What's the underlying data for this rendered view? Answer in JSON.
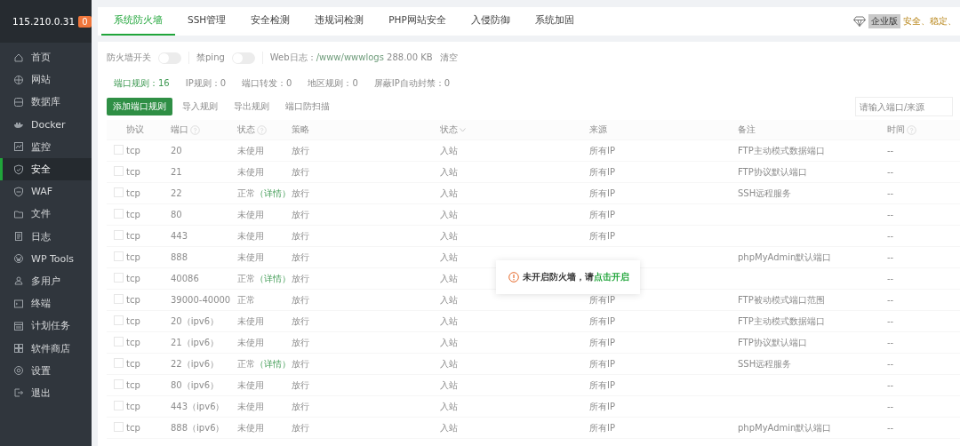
{
  "server": {
    "ip": "115.210.0.31",
    "badge": "0"
  },
  "sidebar": {
    "items": [
      {
        "label": "首页",
        "selected": false
      },
      {
        "label": "网站",
        "selected": false
      },
      {
        "label": "数据库",
        "selected": false
      },
      {
        "label": "Docker",
        "selected": false
      },
      {
        "label": "监控",
        "selected": false
      },
      {
        "label": "安全",
        "selected": true
      },
      {
        "label": "WAF",
        "selected": false
      },
      {
        "label": "文件",
        "selected": false
      },
      {
        "label": "日志",
        "selected": false
      },
      {
        "label": "WP Tools",
        "selected": false
      },
      {
        "label": "多用户",
        "selected": false
      },
      {
        "label": "终端",
        "selected": false
      },
      {
        "label": "计划任务",
        "selected": false
      },
      {
        "label": "软件商店",
        "selected": false
      },
      {
        "label": "设置",
        "selected": false
      },
      {
        "label": "退出",
        "selected": false
      }
    ]
  },
  "tabs": [
    {
      "label": "系统防火墙",
      "selected": true
    },
    {
      "label": "SSH管理",
      "selected": false
    },
    {
      "label": "安全检测",
      "selected": false
    },
    {
      "label": "违规词检测",
      "selected": false
    },
    {
      "label": "PHP网站安全",
      "selected": false
    },
    {
      "label": "入侵防御",
      "selected": false
    },
    {
      "label": "系统加固",
      "selected": false
    }
  ],
  "edition": {
    "badge": "企业版",
    "slogan": "安全、稳定、"
  },
  "settings": {
    "firewall_switch": {
      "label": "防火墙开关",
      "on": false
    },
    "ping_switch": {
      "label": "禁ping",
      "on": false
    },
    "web_log_label": "Web日志：",
    "web_log_path": "/www/wwwlogs",
    "web_log_size": "288.00 KB",
    "clear_link": "清空"
  },
  "rule_tabs": [
    {
      "label": "端口规则：16",
      "selected": true
    },
    {
      "label": "IP规则：0",
      "selected": false
    },
    {
      "label": "端口转发：0",
      "selected": false
    },
    {
      "label": "地区规则：0",
      "selected": false
    },
    {
      "label": "屏蔽IP自动封禁：0",
      "selected": false
    }
  ],
  "buttons": [
    {
      "label": "添加端口规则",
      "kind": "primary"
    },
    {
      "label": "导入规则",
      "kind": "plain"
    },
    {
      "label": "导出规则",
      "kind": "plain"
    },
    {
      "label": "端口防扫描",
      "kind": "plain"
    }
  ],
  "search": {
    "placeholder": "请输入端口/来源"
  },
  "table": {
    "columns": [
      {
        "label": "协议",
        "kind": "plain"
      },
      {
        "label": "端口",
        "kind": "help"
      },
      {
        "label": "状态",
        "kind": "help"
      },
      {
        "label": "策略",
        "kind": "plain"
      },
      {
        "label": "状态",
        "kind": "sort"
      },
      {
        "label": "来源",
        "kind": "plain"
      },
      {
        "label": "备注",
        "kind": "plain"
      },
      {
        "label": "时间",
        "kind": "help"
      }
    ],
    "rows": [
      {
        "checked": false,
        "protocol": "tcp",
        "port": "20",
        "status": "未使用",
        "policy": "放行",
        "direction": "入站",
        "source": "所有IP",
        "note": "FTP主动模式数据端口",
        "time": "--"
      },
      {
        "checked": false,
        "protocol": "tcp",
        "port": "21",
        "status": "未使用",
        "policy": "放行",
        "direction": "入站",
        "source": "所有IP",
        "note": "FTP协议默认端口",
        "time": "--"
      },
      {
        "checked": false,
        "protocol": "tcp",
        "port": "22",
        "status": "正常",
        "detail": "（详情）",
        "policy": "放行",
        "direction": "入站",
        "source": "所有IP",
        "note": "SSH远程服务",
        "time": "--"
      },
      {
        "checked": false,
        "protocol": "tcp",
        "port": "80",
        "status": "未使用",
        "policy": "放行",
        "direction": "入站",
        "source": "所有IP",
        "time": "--"
      },
      {
        "checked": false,
        "protocol": "tcp",
        "port": "443",
        "status": "未使用",
        "policy": "放行",
        "direction": "入站",
        "source": "所有IP",
        "time": "--"
      },
      {
        "checked": false,
        "protocol": "tcp",
        "port": "888",
        "status": "未使用",
        "policy": "放行",
        "direction": "入站",
        "note": "phpMyAdmin默认端口",
        "time": "--"
      },
      {
        "checked": false,
        "protocol": "tcp",
        "port": "40086",
        "status": "正常",
        "detail": "（详情）",
        "policy": "放行",
        "direction": "入站",
        "time": "--"
      },
      {
        "checked": false,
        "protocol": "tcp",
        "port": "39000-40000",
        "status": "正常",
        "policy": "放行",
        "direction": "入站",
        "source": "所有IP",
        "note": "FTP被动模式端口范围",
        "time": "--"
      },
      {
        "checked": false,
        "protocol": "tcp",
        "port": "20（ipv6）",
        "status": "未使用",
        "policy": "放行",
        "direction": "入站",
        "source": "所有IP",
        "note": "FTP主动模式数据端口",
        "time": "--"
      },
      {
        "checked": false,
        "protocol": "tcp",
        "port": "21（ipv6）",
        "status": "未使用",
        "policy": "放行",
        "direction": "入站",
        "source": "所有IP",
        "note": "FTP协议默认端口",
        "time": "--"
      },
      {
        "checked": false,
        "protocol": "tcp",
        "port": "22（ipv6）",
        "status": "正常",
        "detail": "（详情）",
        "policy": "放行",
        "direction": "入站",
        "source": "所有IP",
        "note": "SSH远程服务",
        "time": "--"
      },
      {
        "checked": false,
        "protocol": "tcp",
        "port": "80（ipv6）",
        "status": "未使用",
        "policy": "放行",
        "direction": "入站",
        "source": "所有IP",
        "time": "--"
      },
      {
        "checked": false,
        "protocol": "tcp",
        "port": "443（ipv6）",
        "status": "未使用",
        "policy": "放行",
        "direction": "入站",
        "source": "所有IP",
        "time": "--"
      },
      {
        "checked": false,
        "protocol": "tcp",
        "port": "888（ipv6）",
        "status": "未使用",
        "policy": "放行",
        "direction": "入站",
        "source": "所有IP",
        "note": "phpMyAdmin默认端口",
        "time": "--"
      }
    ]
  },
  "toast": {
    "message": "未开启防火墙，请",
    "link": "点击开启"
  }
}
